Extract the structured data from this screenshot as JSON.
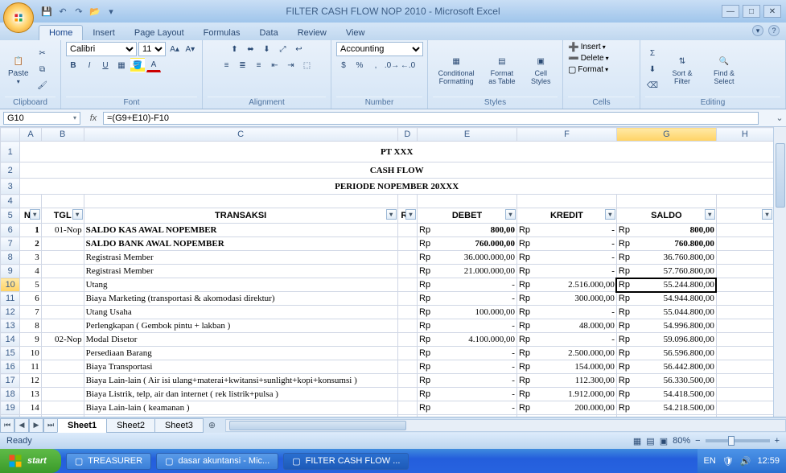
{
  "window": {
    "title": "FILTER CASH FLOW NOP 2010 - Microsoft Excel"
  },
  "ribbon": {
    "tabs": [
      "Home",
      "Insert",
      "Page Layout",
      "Formulas",
      "Data",
      "Review",
      "View"
    ],
    "active_tab": "Home",
    "groups": {
      "clipboard": "Clipboard",
      "font": "Font",
      "alignment": "Alignment",
      "number": "Number",
      "styles": "Styles",
      "cells": "Cells",
      "editing": "Editing"
    },
    "paste": "Paste",
    "font_name": "Calibri",
    "font_size": "11",
    "number_format": "Accounting",
    "cf": "Conditional Formatting",
    "fat": "Format as Table",
    "cs": "Cell Styles",
    "insert": "Insert",
    "delete": "Delete",
    "format": "Format",
    "sort": "Sort & Filter",
    "find": "Find & Select"
  },
  "formula": {
    "namebox": "G10",
    "value": "=(G9+E10)-F10"
  },
  "cols": [
    "A",
    "B",
    "C",
    "D",
    "E",
    "F",
    "G",
    "H"
  ],
  "title1": "PT XXX",
  "title2": "CASH FLOW",
  "title3": "PERIODE NOPEMBER 20XXX",
  "hdr": {
    "no": "NO",
    "tgl": "TGL",
    "tr": "TRANSAKSI",
    "rk": "RK",
    "debet": "DEBET",
    "kredit": "KREDIT",
    "saldo": "SALDO"
  },
  "rows": [
    {
      "n": 1,
      "no": "1",
      "tgl": "01-Nop",
      "tr": "SALDO KAS AWAL NOPEMBER",
      "bold": true,
      "rp_d": "Rp",
      "d": "800,00",
      "rp_k": "Rp",
      "k": "-",
      "rp_s": "Rp",
      "s": "800,00",
      "sb": true
    },
    {
      "n": 2,
      "no": "2",
      "tgl": "",
      "tr": "SALDO BANK AWAL NOPEMBER",
      "bold": true,
      "rp_d": "Rp",
      "d": "760.000,00",
      "rp_k": "Rp",
      "k": "-",
      "rp_s": "Rp",
      "s": "760.800,00",
      "sb": true
    },
    {
      "n": 3,
      "no": "3",
      "tgl": "",
      "tr": "Registrasi Member",
      "rp_d": "Rp",
      "d": "36.000.000,00",
      "rp_k": "Rp",
      "k": "-",
      "rp_s": "Rp",
      "s": "36.760.800,00"
    },
    {
      "n": 4,
      "no": "4",
      "tgl": "",
      "tr": "Registrasi Member",
      "rp_d": "Rp",
      "d": "21.000.000,00",
      "rp_k": "Rp",
      "k": "-",
      "rp_s": "Rp",
      "s": "57.760.800,00"
    },
    {
      "n": 5,
      "no": "5",
      "tgl": "",
      "tr": "Utang",
      "rp_d": "Rp",
      "d": "-",
      "rp_k": "Rp",
      "k": "2.516.000,00",
      "rp_s": "Rp",
      "s": "55.244.800,00",
      "sel": true
    },
    {
      "n": 6,
      "no": "6",
      "tgl": "",
      "tr": "Biaya Marketing (transportasi & akomodasi direktur)",
      "rp_d": "Rp",
      "d": "-",
      "rp_k": "Rp",
      "k": "300.000,00",
      "rp_s": "Rp",
      "s": "54.944.800,00"
    },
    {
      "n": 7,
      "no": "7",
      "tgl": "",
      "tr": "Utang Usaha",
      "rp_d": "Rp",
      "d": "100.000,00",
      "rp_k": "Rp",
      "k": "-",
      "rp_s": "Rp",
      "s": "55.044.800,00"
    },
    {
      "n": 8,
      "no": "8",
      "tgl": "",
      "tr": "Perlengkapan ( Gembok pintu + lakban )",
      "rp_d": "Rp",
      "d": "-",
      "rp_k": "Rp",
      "k": "48.000,00",
      "rp_s": "Rp",
      "s": "54.996.800,00"
    },
    {
      "n": 9,
      "no": "9",
      "tgl": "02-Nop",
      "tr": "Modal Disetor",
      "rp_d": "Rp",
      "d": "4.100.000,00",
      "rp_k": "Rp",
      "k": "-",
      "rp_s": "Rp",
      "s": "59.096.800,00"
    },
    {
      "n": 10,
      "no": "10",
      "tgl": "",
      "tr": "Persediaan Barang",
      "rp_d": "Rp",
      "d": "-",
      "rp_k": "Rp",
      "k": "2.500.000,00",
      "rp_s": "Rp",
      "s": "56.596.800,00"
    },
    {
      "n": 11,
      "no": "11",
      "tgl": "",
      "tr": "Biaya Transportasi",
      "rp_d": "Rp",
      "d": "-",
      "rp_k": "Rp",
      "k": "154.000,00",
      "rp_s": "Rp",
      "s": "56.442.800,00"
    },
    {
      "n": 12,
      "no": "12",
      "tgl": "",
      "tr": "Biaya Lain-lain ( Air isi ulang+materai+kwitansi+sunlight+kopi+konsumsi )",
      "rp_d": "Rp",
      "d": "-",
      "rp_k": "Rp",
      "k": "112.300,00",
      "rp_s": "Rp",
      "s": "56.330.500,00"
    },
    {
      "n": 13,
      "no": "13",
      "tgl": "",
      "tr": "Biaya Listrik, telp, air dan internet ( rek listrik+pulsa )",
      "rp_d": "Rp",
      "d": "-",
      "rp_k": "Rp",
      "k": "1.912.000,00",
      "rp_s": "Rp",
      "s": "54.418.500,00"
    },
    {
      "n": 14,
      "no": "14",
      "tgl": "",
      "tr": "Biaya Lain-lain ( keamanan )",
      "rp_d": "Rp",
      "d": "-",
      "rp_k": "Rp",
      "k": "200.000,00",
      "rp_s": "Rp",
      "s": "54.218.500,00"
    }
  ],
  "sheets": [
    "Sheet1",
    "Sheet2",
    "Sheet3"
  ],
  "active_sheet": 0,
  "status": {
    "ready": "Ready",
    "zoom": "80%"
  },
  "taskbar": {
    "start": "start",
    "tasks": [
      {
        "label": "TREASURER"
      },
      {
        "label": "dasar akuntansi - Mic..."
      },
      {
        "label": "FILTER CASH FLOW ...",
        "active": true
      }
    ],
    "lang": "EN",
    "clock": "12:59"
  }
}
